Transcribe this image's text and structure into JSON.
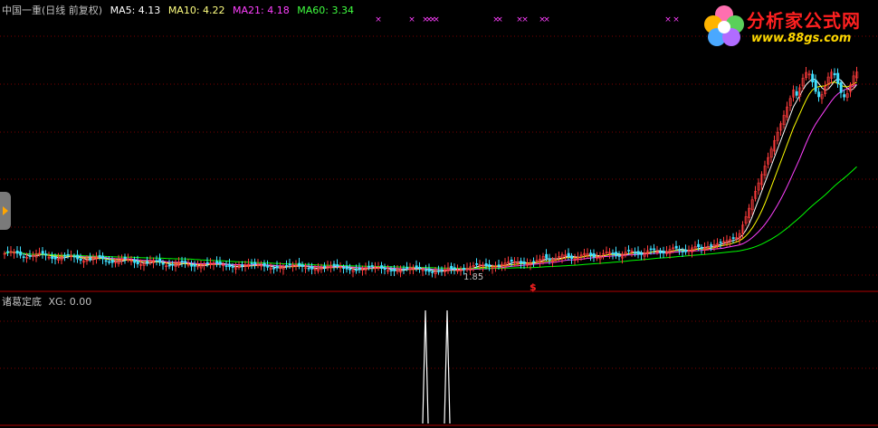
{
  "header": {
    "stock": "中国一重(日线 前复权)",
    "ma5": "MA5: 4.13",
    "ma10": "MA10: 4.22",
    "ma21": "MA21: 4.18",
    "ma60": "MA60: 3.34"
  },
  "indicator": {
    "name": "诸葛定底",
    "xg": "XG: 0.00"
  },
  "low_label": "1.85",
  "signal_marker": "$",
  "brand": {
    "name": "分析家公式网",
    "url": "www.88gs.com"
  },
  "colors": {
    "up": "#ff3c3c",
    "down": "#40e0ff",
    "ma5": "#ffffff",
    "ma10": "#ffff00",
    "ma21": "#ff40ff",
    "ma60": "#00ff00",
    "grid": "#7a0000",
    "xmark": "#ff40ff"
  },
  "chart_data": {
    "type": "candlestick",
    "price_range": [
      1.6,
      6.3
    ],
    "low_value": 1.85,
    "top_markers_count": 14,
    "indicator_signals": [
      1,
      1
    ],
    "indicator_range": [
      0,
      1
    ]
  }
}
